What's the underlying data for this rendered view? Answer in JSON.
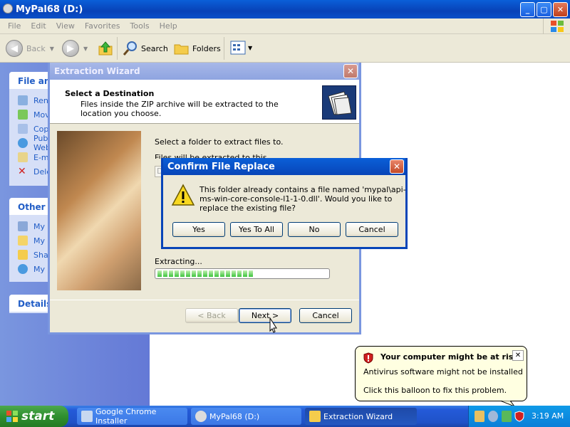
{
  "explorer": {
    "title": "MyPal68 (D:)",
    "menu": [
      "File",
      "Edit",
      "View",
      "Favorites",
      "Tools",
      "Help"
    ],
    "toolbar": {
      "back": "Back",
      "search": "Search",
      "folders": "Folders"
    },
    "file_tasks": {
      "header": "File and Folder Tasks",
      "items": [
        "Rename this file",
        "Move this file",
        "Copy this file",
        "Publish this file to the Web",
        "E-mail this file",
        "Delete this file"
      ]
    },
    "other_places": {
      "header": "Other Places",
      "items": [
        "My Computer",
        "My Documents",
        "Shared Documents",
        "My Network Places"
      ]
    },
    "details": {
      "header": "Details"
    }
  },
  "wizard": {
    "title": "Extraction Wizard",
    "heading": "Select a Destination",
    "subheading": "Files inside the ZIP archive will be extracted to the location you choose.",
    "select_label": "Select a folder to extract files to.",
    "dir_label": "Files will be extracted to this directory:",
    "dir_value": "D:\\",
    "extracting_label": "Extracting...",
    "progress_fraction": 0.55,
    "buttons": {
      "back": "< Back",
      "next": "Next >",
      "cancel": "Cancel"
    }
  },
  "confirm": {
    "title": "Confirm File Replace",
    "message": "This folder already contains a file named 'mypal\\api-ms-win-core-console-l1-1-0.dll'.  Would you like to replace the existing file?",
    "buttons": {
      "yes": "Yes",
      "yes_all": "Yes To All",
      "no": "No",
      "cancel": "Cancel"
    }
  },
  "balloon": {
    "title": "Your computer might be at risk",
    "line1": "Antivirus software might not be installed",
    "line2": "Click this balloon to fix this problem."
  },
  "taskbar": {
    "start": "start",
    "tasks": [
      "Google Chrome Installer",
      "MyPal68 (D:)",
      "Extraction Wizard"
    ],
    "clock": "3:19 AM"
  },
  "colors": {
    "xp_blue": "#0a5fd8",
    "start_green": "#2f8f2f",
    "balloon_bg": "#ffffe1",
    "progress_green": "#3cc43c"
  }
}
